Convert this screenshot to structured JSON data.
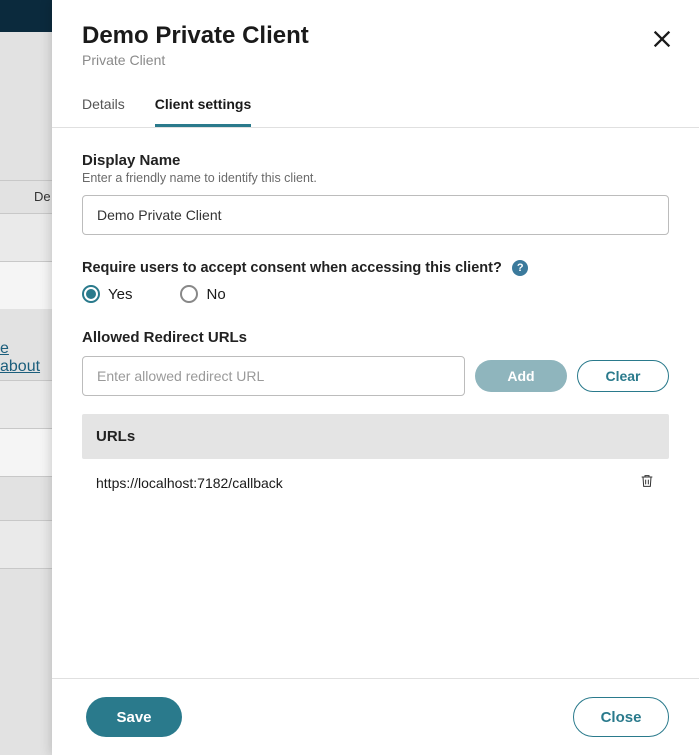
{
  "background": {
    "de_label": "De",
    "learn_link": "e about"
  },
  "header": {
    "title": "Demo Private Client",
    "subtitle": "Private Client"
  },
  "tabs": {
    "details": "Details",
    "client_settings": "Client settings"
  },
  "display_name": {
    "label": "Display Name",
    "help": "Enter a friendly name to identify this client.",
    "value": "Demo Private Client"
  },
  "consent": {
    "label": "Require users to accept consent when accessing this client?",
    "help_icon": "?",
    "options": {
      "yes": "Yes",
      "no": "No"
    }
  },
  "redirect": {
    "label": "Allowed Redirect URLs",
    "input_placeholder": "Enter allowed redirect URL",
    "add_label": "Add",
    "clear_label": "Clear",
    "table_header": "URLs",
    "rows": [
      {
        "url": "https://localhost:7182/callback"
      }
    ]
  },
  "footer": {
    "save_label": "Save",
    "close_label": "Close"
  }
}
